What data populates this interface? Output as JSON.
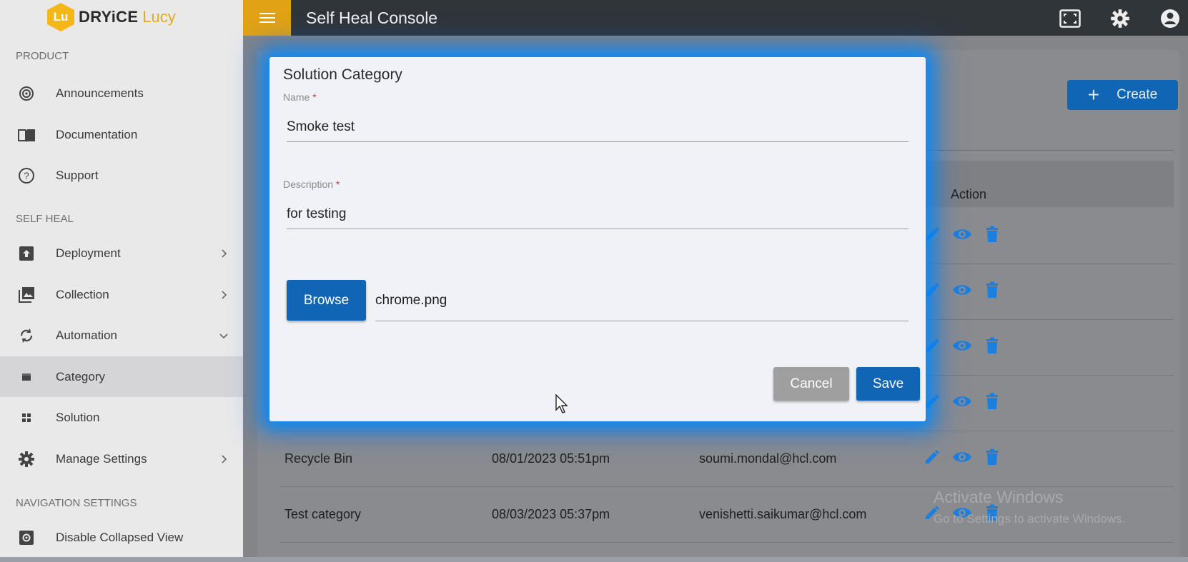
{
  "brand": {
    "logo_text": "Lu",
    "name": "DRYiCE",
    "product": "Lucy"
  },
  "topbar": {
    "title": "Self Heal Console",
    "icons": [
      "fullscreen-icon",
      "gear-icon",
      "account-icon"
    ]
  },
  "sidebar": {
    "sections": [
      {
        "label": "PRODUCT"
      },
      {
        "label": "SELF HEAL"
      },
      {
        "label": "NAVIGATION SETTINGS"
      }
    ],
    "items": [
      {
        "label": "Announcements",
        "icon": "announcement-icon"
      },
      {
        "label": "Documentation",
        "icon": "book-icon"
      },
      {
        "label": "Support",
        "icon": "help-icon"
      },
      {
        "label": "Deployment",
        "icon": "deployment-icon"
      },
      {
        "label": "Collection",
        "icon": "collection-icon"
      },
      {
        "label": "Automation",
        "icon": "sync-icon"
      },
      {
        "label": "Category",
        "icon": "category-icon",
        "active": true
      },
      {
        "label": "Solution",
        "icon": "grid-icon"
      },
      {
        "label": "Manage Settings",
        "icon": "gear-icon"
      },
      {
        "label": "Disable Collapsed View",
        "icon": "settings-box-icon"
      }
    ]
  },
  "main": {
    "create_label": "Create",
    "table": {
      "action_header": "Action",
      "rows": [
        {
          "name": "",
          "date": "",
          "email": ""
        },
        {
          "name": "",
          "date": "",
          "email": ""
        },
        {
          "name": "",
          "date": "",
          "email": ""
        },
        {
          "name": "",
          "date": "",
          "email": ""
        },
        {
          "name": "Recycle Bin",
          "date": "08/01/2023 05:51pm",
          "email": "soumi.mondal@hcl.com"
        },
        {
          "name": "Test category",
          "date": "08/03/2023 05:37pm",
          "email": "venishetti.saikumar@hcl.com"
        }
      ]
    }
  },
  "modal": {
    "title": "Solution Category",
    "name_label": "Name",
    "name_value": "Smoke test",
    "description_label": "Description",
    "description_value": "for testing",
    "required_mark": "*",
    "browse_label": "Browse",
    "file_name": "chrome.png",
    "cancel_label": "Cancel",
    "save_label": "Save"
  },
  "watermark": {
    "line1": "Activate Windows",
    "line2": "Go to Settings to activate Windows."
  },
  "colors": {
    "primary": "#1065b5",
    "accent": "#e2a215",
    "topbar": "#30353a",
    "action_icon": "#1b7fe0"
  }
}
